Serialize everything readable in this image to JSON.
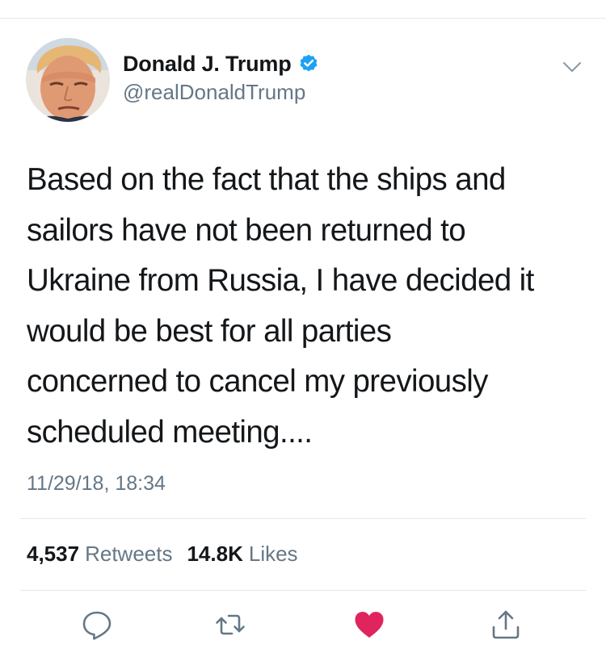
{
  "author": {
    "display_name": "Donald J. Trump",
    "handle": "@realDonaldTrump",
    "verified": true,
    "avatar_icon": "profile-photo"
  },
  "tweet": {
    "lines": [
      "Based on the fact that the ships and",
      "sailors have not been returned to",
      "Ukraine from Russia, I have decided it",
      "would be best for all parties",
      "concerned to cancel my previously",
      "scheduled meeting...."
    ],
    "timestamp": "11/29/18, 18:34"
  },
  "stats": {
    "retweets_count": "4,537",
    "retweets_label": "Retweets",
    "likes_count": "14.8K",
    "likes_label": "Likes"
  },
  "actions": {
    "reply_icon": "reply-icon",
    "retweet_icon": "retweet-icon",
    "like_icon": "heart-icon",
    "like_active": true,
    "share_icon": "share-icon"
  },
  "colors": {
    "verified_blue": "#1da1f2",
    "like_red": "#e0245e",
    "secondary_text": "#657786",
    "icon_gray": "#657786",
    "divider": "#e1e8ed"
  }
}
